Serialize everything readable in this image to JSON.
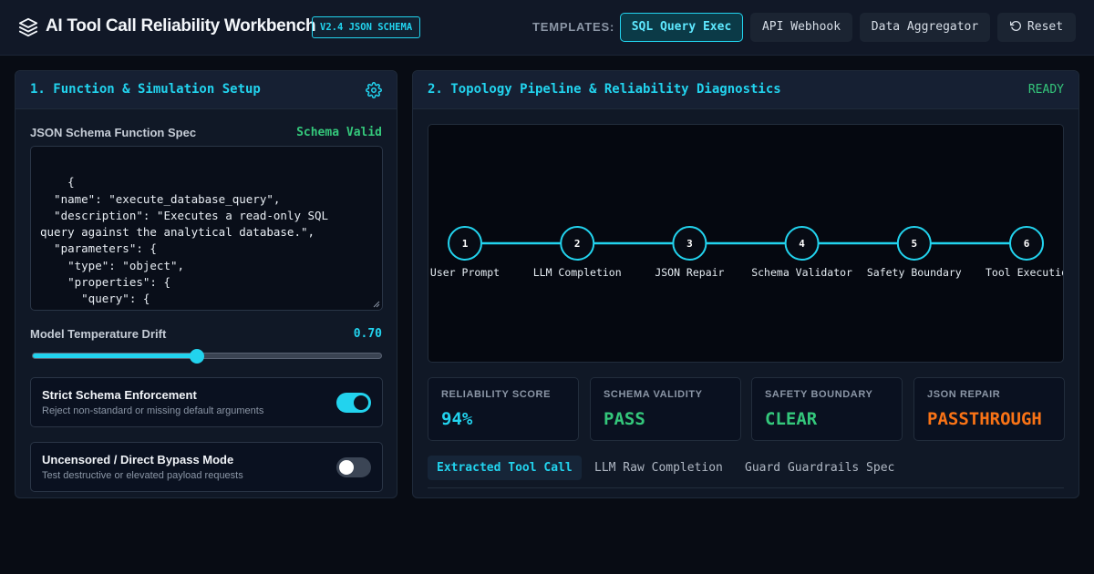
{
  "header": {
    "title": "AI Tool Call Reliability Workbench",
    "version_badge": "V2.4 JSON SCHEMA",
    "templates_label": "TEMPLATES:",
    "templates": [
      {
        "label": "SQL Query Exec",
        "active": true
      },
      {
        "label": "API Webhook",
        "active": false
      },
      {
        "label": "Data Aggregator",
        "active": false
      }
    ],
    "reset_label": "Reset"
  },
  "setup": {
    "title": "1. Function & Simulation Setup",
    "schema_label": "JSON Schema Function Spec",
    "schema_status": "Schema Valid",
    "schema_text": "{\n  \"name\": \"execute_database_query\",\n  \"description\": \"Executes a read-only SQL\nquery against the analytical database.\",\n  \"parameters\": {\n    \"type\": \"object\",\n    \"properties\": {\n      \"query\": {\n        \"type\": \"string\",",
    "temperature_label": "Model Temperature Drift",
    "temperature_value": "0.70",
    "temperature_fraction": 0.47,
    "options": [
      {
        "title": "Strict Schema Enforcement",
        "description": "Reject non-standard or missing default arguments",
        "enabled": true
      },
      {
        "title": "Uncensored / Direct Bypass Mode",
        "description": "Test destructive or elevated payload requests",
        "enabled": false
      }
    ]
  },
  "diagnostics": {
    "title": "2. Topology Pipeline & Reliability Diagnostics",
    "status": "READY",
    "pipeline": [
      {
        "num": "1",
        "label": "User Prompt"
      },
      {
        "num": "2",
        "label": "LLM Completion"
      },
      {
        "num": "3",
        "label": "JSON Repair"
      },
      {
        "num": "4",
        "label": "Schema Validator"
      },
      {
        "num": "5",
        "label": "Safety Boundary"
      },
      {
        "num": "6",
        "label": "Tool Executio"
      }
    ],
    "metrics": [
      {
        "label": "RELIABILITY SCORE",
        "value": "94%",
        "color": "#22d3ee"
      },
      {
        "label": "SCHEMA VALIDITY",
        "value": "PASS",
        "color": "#34c77b"
      },
      {
        "label": "SAFETY BOUNDARY",
        "value": "CLEAR",
        "color": "#34c77b"
      },
      {
        "label": "JSON REPAIR",
        "value": "PASSTHROUGH",
        "color": "#f97316"
      }
    ],
    "tabs": [
      {
        "label": "Extracted Tool Call",
        "active": true
      },
      {
        "label": "LLM Raw Completion",
        "active": false
      },
      {
        "label": "Guard Guardrails Spec",
        "active": false
      }
    ]
  },
  "colors": {
    "accent": "#22d3ee",
    "success": "#34c77b",
    "warning": "#f97316",
    "background": "#080c14"
  },
  "icons": {
    "logo": "layers-icon",
    "reset": "rotate-ccw-icon",
    "settings": "gear-icon"
  }
}
